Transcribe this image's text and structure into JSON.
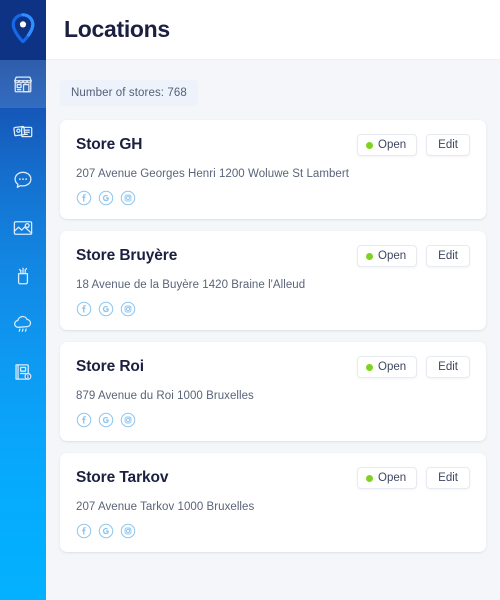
{
  "app": {
    "logo_icon": "location-pin-icon"
  },
  "sidebar": {
    "items": [
      {
        "icon": "storefront-icon",
        "name": "stores",
        "active": true
      },
      {
        "icon": "cards-money-icon",
        "name": "payments",
        "active": false
      },
      {
        "icon": "chat-bubble-icon",
        "name": "messages",
        "active": false
      },
      {
        "icon": "media-image-icon",
        "name": "media",
        "active": false
      },
      {
        "icon": "analytics-cup-icon",
        "name": "analytics",
        "active": false
      },
      {
        "icon": "cloud-rain-icon",
        "name": "weather",
        "active": false
      },
      {
        "icon": "book-info-icon",
        "name": "documentation",
        "active": false
      }
    ]
  },
  "header": {
    "title": "Locations"
  },
  "main": {
    "store_count_label": "Number of stores: 768",
    "status_label": "Open",
    "edit_label": "Edit",
    "social_icons": [
      "facebook-icon",
      "google-icon",
      "instagram-icon"
    ],
    "stores": [
      {
        "name": "Store GH",
        "address": "207 Avenue Georges Henri 1200 Woluwe St Lambert",
        "status": "Open",
        "edit": "Edit"
      },
      {
        "name": "Store Bruyère",
        "address": "18 Avenue de la Buyère 1420 Braine l'Alleud",
        "status": "Open",
        "edit": "Edit"
      },
      {
        "name": "Store Roi",
        "address": "879 Avenue du Roi 1000 Bruxelles",
        "status": "Open",
        "edit": "Edit"
      },
      {
        "name": "Store Tarkov",
        "address": "207 Avenue Tarkov 1000 Bruxelles",
        "status": "Open",
        "edit": "Edit"
      }
    ]
  },
  "colors": {
    "sidebar_top": "#103a8e",
    "sidebar_bottom": "#03b1ff",
    "accent_green": "#7ed321",
    "title_text": "#1b2040",
    "page_bg": "#f4f6f9"
  }
}
